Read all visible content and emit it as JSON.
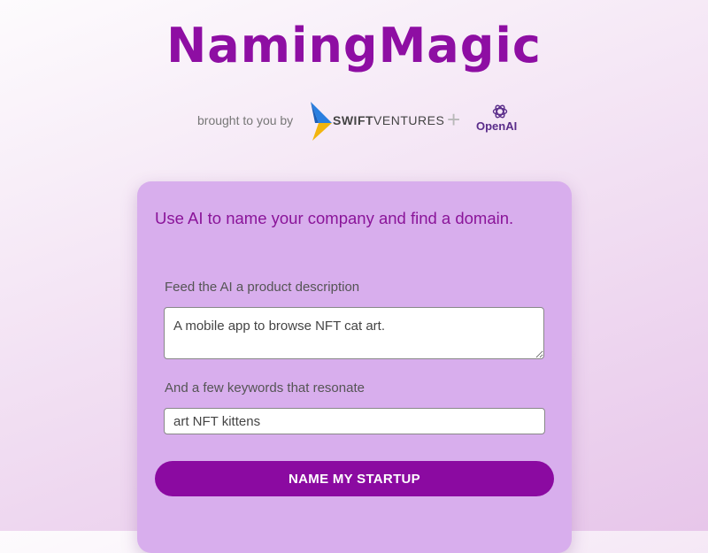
{
  "header": {
    "title": "NamingMagic",
    "brought_by": "brought to you by",
    "swift_bold": "SWIFT",
    "swift_rest": "VENTURES",
    "plus": "+",
    "openai": "OpenAI"
  },
  "card": {
    "heading": "Use AI to name your company and find a domain.",
    "description_label": "Feed the AI a product description",
    "description_value": "A mobile app to browse NFT cat art.",
    "keywords_label": "And a few keywords that resonate",
    "keywords_value": "art NFT kittens",
    "submit_label": "NAME MY STARTUP"
  },
  "colors": {
    "brand": "#8e0ea3",
    "card_bg": "#d8aeed",
    "button": "#8b0aa1"
  },
  "icons": {
    "swift": "swift-ventures-logo-icon",
    "openai": "openai-logo-icon"
  }
}
